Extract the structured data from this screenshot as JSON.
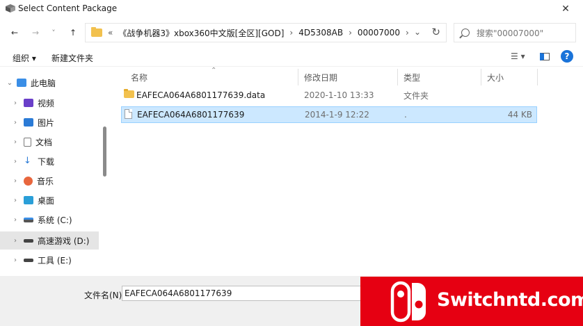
{
  "window": {
    "title": "Select Content Package",
    "close_glyph": "✕"
  },
  "nav": {
    "back_glyph": "←",
    "forward_glyph": "→",
    "recent_glyph": "˅",
    "up_glyph": "↑"
  },
  "address": {
    "overflow": "«",
    "segments": [
      "《战争机器3》xbox360中文版[全区][GOD]",
      "4D5308AB",
      "00007000"
    ],
    "separator": "›",
    "dropdown_glyph": "⌄",
    "refresh_glyph": "↻"
  },
  "search": {
    "placeholder": "搜索\"00007000\""
  },
  "toolbar": {
    "organize": "组织 ▾",
    "new_folder": "新建文件夹",
    "view_glyph": "☰ ▾",
    "help_glyph": "?"
  },
  "sidebar": {
    "items": [
      {
        "label": "此电脑",
        "chevron": "⌄",
        "icon": "pc-icon"
      },
      {
        "label": "视频",
        "chevron": "›",
        "icon": "video-icon"
      },
      {
        "label": "图片",
        "chevron": "›",
        "icon": "picture-icon"
      },
      {
        "label": "文档",
        "chevron": "›",
        "icon": "document-icon"
      },
      {
        "label": "下载",
        "chevron": "›",
        "icon": "download-icon"
      },
      {
        "label": "音乐",
        "chevron": "›",
        "icon": "music-icon"
      },
      {
        "label": "桌面",
        "chevron": "›",
        "icon": "desktop-icon"
      },
      {
        "label": "系统 (C:)",
        "chevron": "›",
        "icon": "drive-icon"
      },
      {
        "label": "高速游戏 (D:)",
        "chevron": "›",
        "icon": "drive-icon"
      },
      {
        "label": "工具 (E:)",
        "chevron": "›",
        "icon": "drive-icon"
      }
    ]
  },
  "list": {
    "columns": {
      "name": "名称",
      "modified": "修改日期",
      "type": "类型",
      "size": "大小"
    },
    "rows": [
      {
        "name": "EAFECA064A6801177639.data",
        "modified": "2020-1-10 13:33",
        "type": "文件夹",
        "size": "",
        "icon": "folder-icon"
      },
      {
        "name": "EAFECA064A6801177639",
        "modified": "2014-1-9 12:22",
        "type": ".",
        "size": "44 KB",
        "icon": "file-icon"
      }
    ]
  },
  "bottom": {
    "filename_label": "文件名(N):",
    "filename_value": "EAFECA064A6801177639"
  },
  "watermark": {
    "text": "Switchntd.com"
  },
  "colors": {
    "selection": "#cce8ff",
    "watermark_red": "#e60012",
    "folder": "#f2c14e"
  }
}
